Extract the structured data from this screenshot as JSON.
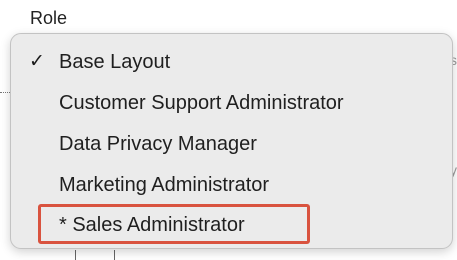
{
  "field": {
    "label": "Role"
  },
  "menu": {
    "items": [
      {
        "label": "Base Layout",
        "checked": true
      },
      {
        "label": "Customer Support Administrator",
        "checked": false
      },
      {
        "label": "Data Privacy Manager",
        "checked": false
      },
      {
        "label": "Marketing Administrator",
        "checked": false
      },
      {
        "label": "* Sales Administrator",
        "checked": false,
        "highlighted": true
      }
    ],
    "check_glyph": "✓"
  },
  "colors": {
    "menu_background": "#ebebeb",
    "highlight_border": "#d9533f"
  },
  "background": {
    "right_edge_glyph_1": "s",
    "right_edge_glyph_2": "y"
  }
}
